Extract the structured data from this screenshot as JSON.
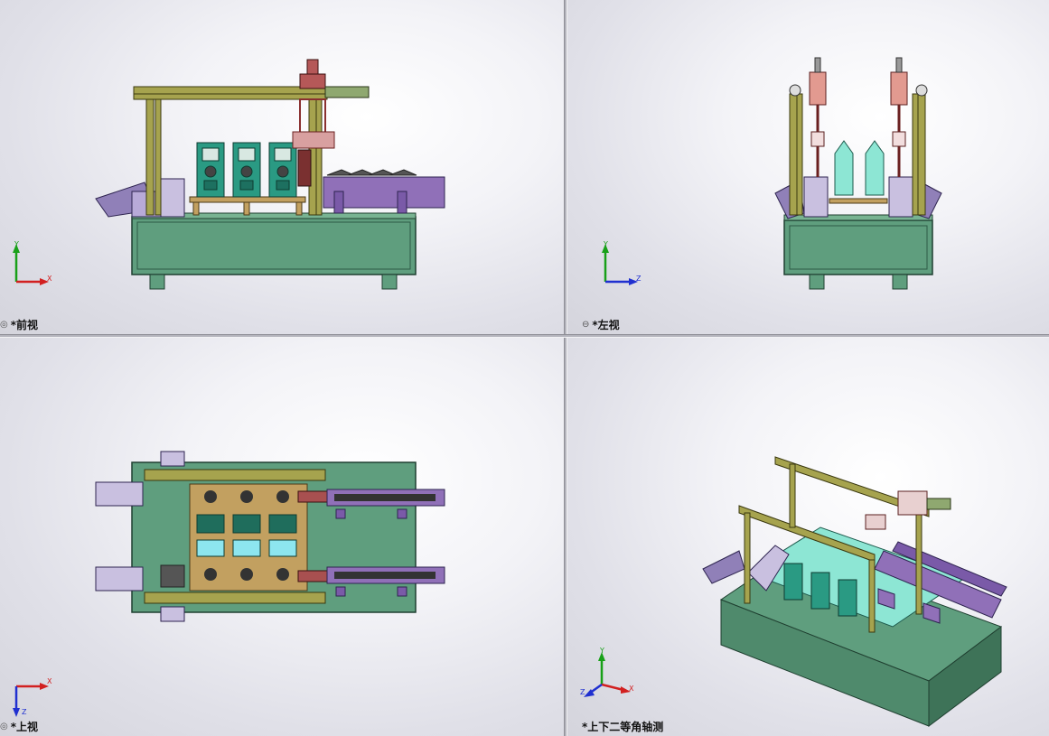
{
  "viewports": {
    "front": {
      "label": "*前视",
      "axis_h": "X",
      "axis_v": "Y"
    },
    "left": {
      "label": "*左视",
      "axis_h": "Z",
      "axis_v": "Y"
    },
    "top": {
      "label": "*上视",
      "axis_h": "X",
      "axis_v": "Z"
    },
    "iso": {
      "label": "*上下二等角轴测",
      "axis_1": "X",
      "axis_2": "Y",
      "axis_3": "Z"
    }
  },
  "colors": {
    "base": "#5f9e7e",
    "frame": "#a6a34e",
    "conveyor": "#9070b8",
    "lavender": "#c9c0e0",
    "teal": "#2a9a83",
    "mint": "#8de6d4",
    "wood": "#c2a060",
    "red": "#a85050",
    "axis_x": "#d22020",
    "axis_y": "#18a018",
    "axis_z": "#2030d0"
  }
}
